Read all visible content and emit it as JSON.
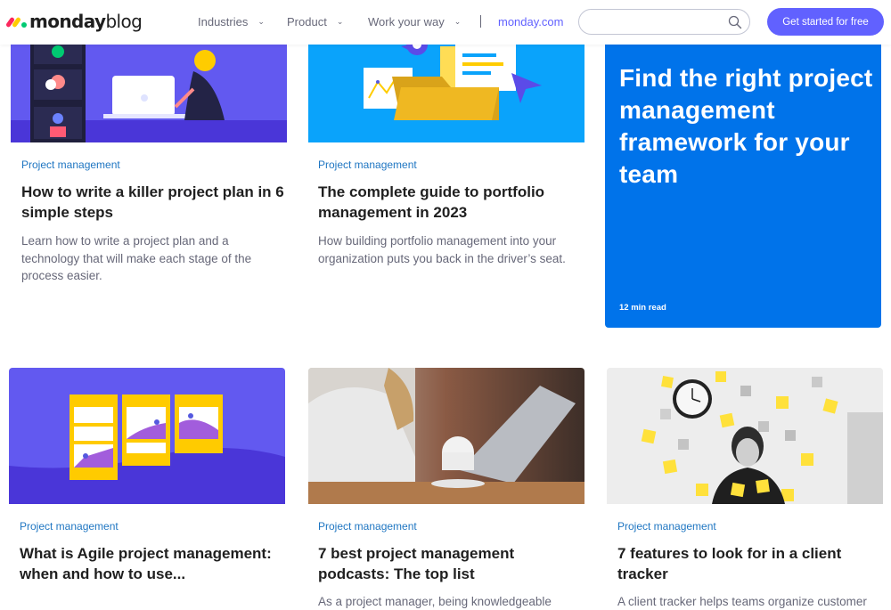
{
  "header": {
    "logo_bold": "monday",
    "logo_light": "blog",
    "nav": [
      {
        "label": "Industries"
      },
      {
        "label": "Product"
      },
      {
        "label": "Work your way"
      }
    ],
    "site_link": "monday.com",
    "search_placeholder": "",
    "cta_label": "Get started for free",
    "colors": {
      "accent": "#6161ff",
      "feature": "#0073ea",
      "tag": "#1f76c2"
    }
  },
  "featured": {
    "title": "Find the right project management framework for your team",
    "read_time": "12 min read"
  },
  "cards": [
    {
      "tag": "Project management",
      "title": "How to write a killer project plan in 6 simple steps",
      "desc": "Learn how to write a project plan and a technology that will make each stage of the process easier."
    },
    {
      "tag": "Project management",
      "title": "The complete guide to portfolio management in 2023",
      "desc": "How building portfolio management into your organization puts you back in the driver’s seat."
    },
    {
      "tag": "Project management",
      "title": "What is Agile project management: when and how to use...",
      "desc": ""
    },
    {
      "tag": "Project management",
      "title": "7 best project management podcasts: The top list",
      "desc": "As a project manager, being knowledgeable"
    },
    {
      "tag": "Project management",
      "title": "7 features to look for in a client tracker",
      "desc": "A client tracker helps teams organize customer"
    }
  ]
}
